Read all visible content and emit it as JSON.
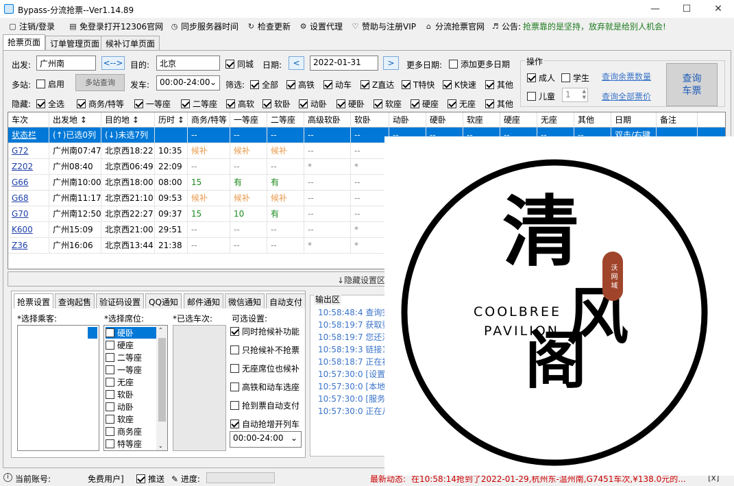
{
  "title": "Bypass-分流抢票--Ver1.14.89",
  "menu": [
    {
      "icon": "user-icon",
      "label": "注销/登录"
    },
    {
      "icon": "login-icon",
      "label": "免登录打开12306官网"
    },
    {
      "icon": "clock-icon",
      "label": "同步服务器时间"
    },
    {
      "icon": "refresh-icon",
      "label": "检查更新"
    },
    {
      "icon": "gear-icon",
      "label": "设置代理"
    },
    {
      "icon": "heart-icon",
      "label": "赞助与注册VIP"
    },
    {
      "icon": "home-icon",
      "label": "分流抢票官网"
    },
    {
      "icon": "speaker-icon",
      "label": "公告: "
    }
  ],
  "notice": "抢票靠的是坚持，放弃就是给别人机会!",
  "tabs": [
    "抢票页面",
    "订单管理页面",
    "候补订单页面"
  ],
  "search": {
    "from_label": "出发:",
    "from": "广州南",
    "swap": "<-->",
    "to_label": "目的:",
    "to": "北京",
    "samecity": "同城",
    "date_label": "日期:",
    "date": "2022-01-31",
    "prev": "<",
    "next": ">",
    "moredate_label": "更多日期:",
    "moredate": "添加更多日期",
    "multi_label": "多站:",
    "multi_enable": "启用",
    "multi_btn": "多站查询",
    "depart_label": "发车:",
    "depart": "00:00-24:00",
    "filter_label": "筛选:",
    "filters": [
      "全部",
      "高铁",
      "动车",
      "Z直达",
      "T特快",
      "K快速",
      "其他"
    ],
    "hide_label": "隐藏:",
    "hides": [
      "全选",
      "商务/特等",
      "一等座",
      "二等座",
      "高软",
      "软卧",
      "动卧",
      "硬卧",
      "软座",
      "硬座",
      "无座",
      "其他"
    ]
  },
  "ops": {
    "title": "操作",
    "adult": "成人",
    "student": "学生",
    "child": "儿童",
    "child_count": "1",
    "query_remain": "查询余票数量",
    "query_price": "查询全部票价",
    "query_btn_1": "查询",
    "query_btn_2": "车票"
  },
  "columns": [
    "车次",
    "出发地 ↕",
    "目的地 ↕",
    "历时 ↕",
    "商务/特等",
    "一等座",
    "二等座",
    "高级软卧",
    "软卧",
    "动卧",
    "硬卧",
    "软座",
    "硬座",
    "无座",
    "其他",
    "日期",
    "备注"
  ],
  "status_row": [
    "状态栏",
    "(↑)已选0列",
    "(↓)未选7列",
    "",
    "--",
    "--",
    "--",
    "--",
    "--",
    "--",
    "--",
    "--",
    "--",
    "--",
    "--",
    "双击/右键",
    ""
  ],
  "rows": [
    [
      "G72",
      "广州南07:47",
      "北京西18:22",
      "10:35",
      "候补",
      "候补",
      "候补",
      "--",
      "--"
    ],
    [
      "Z202",
      "广州08:40",
      "北京西06:49",
      "22:09",
      "--",
      "--",
      "--",
      "*",
      "*"
    ],
    [
      "G66",
      "广州南10:00",
      "北京西18:00",
      "08:00",
      "15",
      "有",
      "有",
      "--",
      "--"
    ],
    [
      "G68",
      "广州南11:17",
      "北京西21:10",
      "09:53",
      "候补",
      "候补",
      "候补",
      "--",
      "--"
    ],
    [
      "G70",
      "广州南12:50",
      "北京西22:27",
      "09:37",
      "15",
      "10",
      "有",
      "--",
      "--"
    ],
    [
      "K600",
      "广州15:09",
      "北京西21:00",
      "29:51",
      "--",
      "--",
      "--",
      "--",
      "*"
    ],
    [
      "Z36",
      "广州16:06",
      "北京西13:44",
      "21:38",
      "--",
      "--",
      "--",
      "*",
      "*"
    ]
  ],
  "hidden_setting": "↓隐藏设置区",
  "btabs": [
    "抢票设置",
    "查询起售",
    "验证码设置",
    "QQ通知",
    "邮件通知",
    "微信通知",
    "自动支付"
  ],
  "settings": {
    "passenger_label": "*选择乘客:",
    "seat_label": "*选择席位:",
    "train_label": "*已选车次:",
    "opt_label": "可选设置:",
    "seats": [
      "硬卧",
      "硬座",
      "二等座",
      "一等座",
      "无座",
      "软卧",
      "动卧",
      "软座",
      "商务座",
      "特等座"
    ],
    "options": [
      {
        "label": "同时抢候补功能",
        "on": true
      },
      {
        "label": "只抢候补不抢票",
        "on": false
      },
      {
        "label": "无座席位也候补",
        "on": false
      },
      {
        "label": "高铁和动车选座",
        "on": false
      },
      {
        "label": "抢到票自动支付",
        "on": false
      },
      {
        "label": "自动抢增开列车",
        "on": true
      }
    ],
    "time_range": "00:00-24:00"
  },
  "output": {
    "title": "输出区",
    "logs": [
      {
        "t": "10:58:48:4",
        "m": "查询完"
      },
      {
        "t": "10:58:19:7",
        "m": "获取要"
      },
      {
        "t": "10:58:19:7",
        "m": "您还没"
      },
      {
        "t": "10:58:19:3",
        "m": "链接1"
      },
      {
        "t": "10:58:18:7",
        "m": "正在初"
      },
      {
        "t": "10:57:30:0",
        "m": "[设置"
      },
      {
        "t": "10:57:30:0",
        "m": "[本地"
      },
      {
        "t": "10:57:30:0",
        "m": "[服务"
      },
      {
        "t": "10:57:30:0",
        "m": "正在从"
      }
    ]
  },
  "status": {
    "account_label": "当前账号:",
    "account": "免费用户]",
    "push": "推送",
    "progress": "进度:",
    "latest": "最新动态:",
    "latest_text": "在10:58:14抢到了2022-01-29,杭州东-温州南,G7451车次,¥138.0元的...",
    "latest_tail": "[x]"
  },
  "watermark": {
    "ch1": "清",
    "ch2": "风",
    "ch3": "阁",
    "en1": "COOLBREE",
    "en2": "PAVILION",
    "seal": "沃 网 域"
  }
}
